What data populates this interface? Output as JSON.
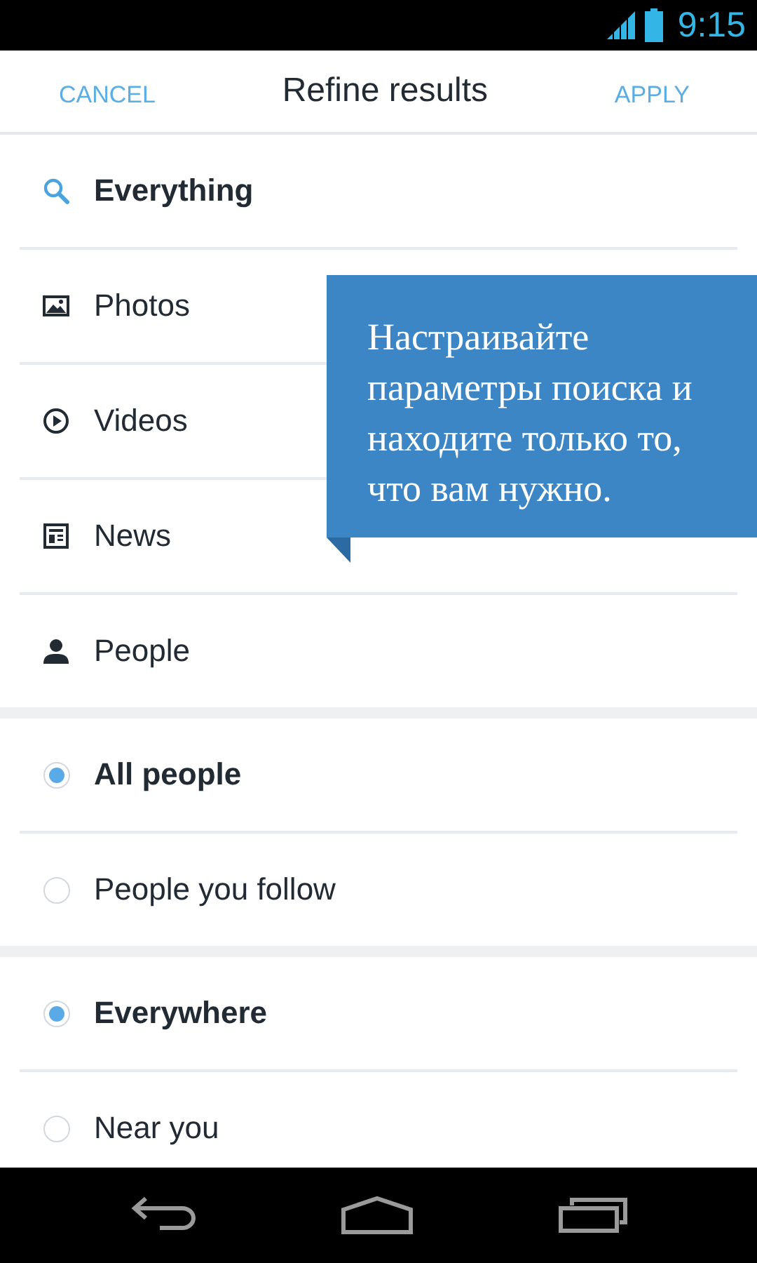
{
  "status_bar": {
    "time": "9:15"
  },
  "header": {
    "cancel": "CANCEL",
    "title": "Refine results",
    "apply": "APPLY"
  },
  "result_types": [
    {
      "kind": "search",
      "label": "Everything",
      "selected": true
    },
    {
      "kind": "photo",
      "label": "Photos",
      "selected": false
    },
    {
      "kind": "video",
      "label": "Videos",
      "selected": false
    },
    {
      "kind": "news",
      "label": "News",
      "selected": false
    },
    {
      "kind": "person",
      "label": "People",
      "selected": false
    }
  ],
  "people_filter": [
    {
      "label": "All people",
      "selected": true
    },
    {
      "label": "People you follow",
      "selected": false
    }
  ],
  "location_filter": [
    {
      "label": "Everywhere",
      "selected": true
    },
    {
      "label": "Near you",
      "selected": false
    }
  ],
  "callout": {
    "text": "Настраивайте параметры поиска и находите только то, что вам нужно."
  }
}
